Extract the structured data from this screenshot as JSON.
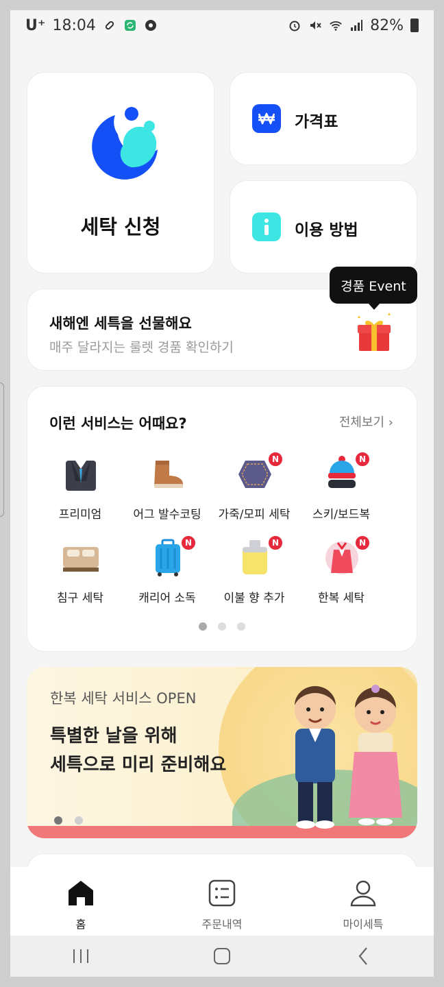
{
  "status_bar": {
    "carrier": "U⁺",
    "time": "18:04",
    "battery": "82%"
  },
  "colors": {
    "brand_blue": "#1450f5",
    "brand_cyan": "#3ee6e3",
    "badge_red": "#e8283b"
  },
  "main": {
    "wash_label": "세탁 신청",
    "price_label": "가격표",
    "usage_label": "이용 방법"
  },
  "event": {
    "title": "새해엔 세특을 선물해요",
    "subtitle": "매주 달라지는 룰렛 경품 확인하기",
    "tooltip": "경품 Event"
  },
  "services": {
    "title": "이런 서비스는 어때요?",
    "see_all": "전체보기",
    "badge_text": "N",
    "items": [
      {
        "label": "프리미엄",
        "icon": "suit-icon",
        "badge": false
      },
      {
        "label": "어그 발수코팅",
        "icon": "ugg-boot-icon",
        "badge": false
      },
      {
        "label": "가죽/모피 세탁",
        "icon": "leather-icon",
        "badge": true
      },
      {
        "label": "스키/보드복",
        "icon": "ski-wear-icon",
        "badge": true
      },
      {
        "label": "침구 세탁",
        "icon": "bedding-icon",
        "badge": false
      },
      {
        "label": "캐리어 소독",
        "icon": "suitcase-icon",
        "badge": true
      },
      {
        "label": "이불 향 추가",
        "icon": "fragrance-icon",
        "badge": true
      },
      {
        "label": "한복 세탁",
        "icon": "hanbok-icon",
        "badge": true
      }
    ],
    "page_count": 3,
    "active_page": 1
  },
  "banner": {
    "subtitle": "한복 세탁 서비스 OPEN",
    "title_line1": "특별한 날을 위해",
    "title_line2": "세특으로 미리 준비해요",
    "page_count": 2,
    "active_page": 1
  },
  "bottom_nav": {
    "home": "홈",
    "orders": "주문내역",
    "my": "마이세특"
  }
}
